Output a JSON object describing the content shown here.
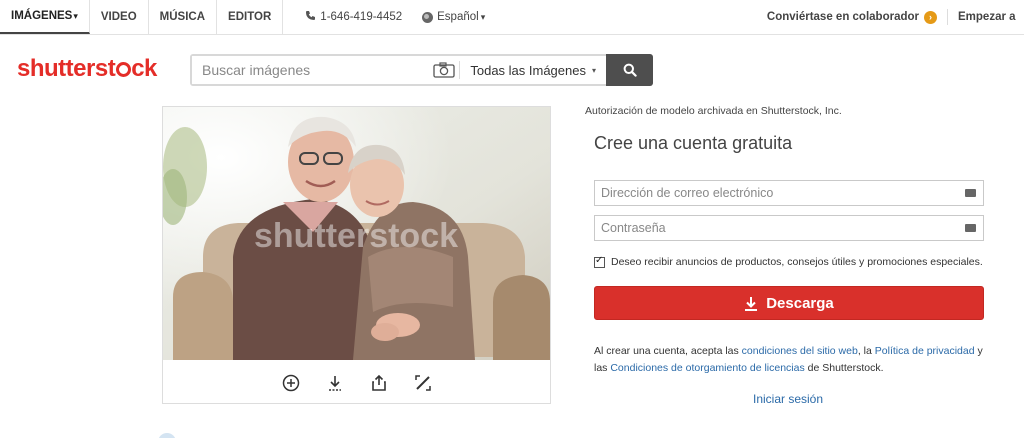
{
  "nav": {
    "tabs": [
      {
        "label": "IMÁGENES",
        "caret": "▾"
      },
      {
        "label": "VIDEO"
      },
      {
        "label": "MÚSICA"
      },
      {
        "label": "EDITOR"
      }
    ],
    "phone": "1-646-419-4452",
    "language": "Español",
    "language_caret": "▾",
    "contributor": "Conviértase en colaborador",
    "contributor_arrow": "›",
    "start": "Empezar a"
  },
  "header": {
    "logo": {
      "part1": "shutterst",
      "part2": "ck"
    },
    "search": {
      "placeholder": "Buscar imágenes",
      "category": "Todas las Imágenes",
      "category_caret": "▾"
    }
  },
  "image": {
    "watermark": "shutterstock",
    "tools": [
      "zoom-in-icon",
      "download-icon",
      "share-icon",
      "edit-icon"
    ]
  },
  "form": {
    "auth_note": "Autorización de modelo archivada en Shutterstock, Inc.",
    "title": "Cree una cuenta gratuita",
    "email_placeholder": "Dirección de correo electrónico",
    "password_placeholder": "Contraseña",
    "checkbox_label": "Deseo recibir anuncios de productos, consejos útiles y promociones especiales.",
    "download_label": "Descarga",
    "terms": {
      "t1": "Al crear una cuenta, acepta las ",
      "link1": "condiciones del sitio web",
      "t2": ", la ",
      "link2": "Política de privacidad",
      "t3": " y las ",
      "link3": "Condiciones de otorgamiento de licencias",
      "t4": " de Shutterstock."
    },
    "login": "Iniciar sesión"
  },
  "colors": {
    "brand": "#e42d28",
    "button": "#d9302b",
    "link": "#2b6aa8",
    "search_button": "#4e4e4e",
    "contributor_badge": "#e59a17"
  }
}
